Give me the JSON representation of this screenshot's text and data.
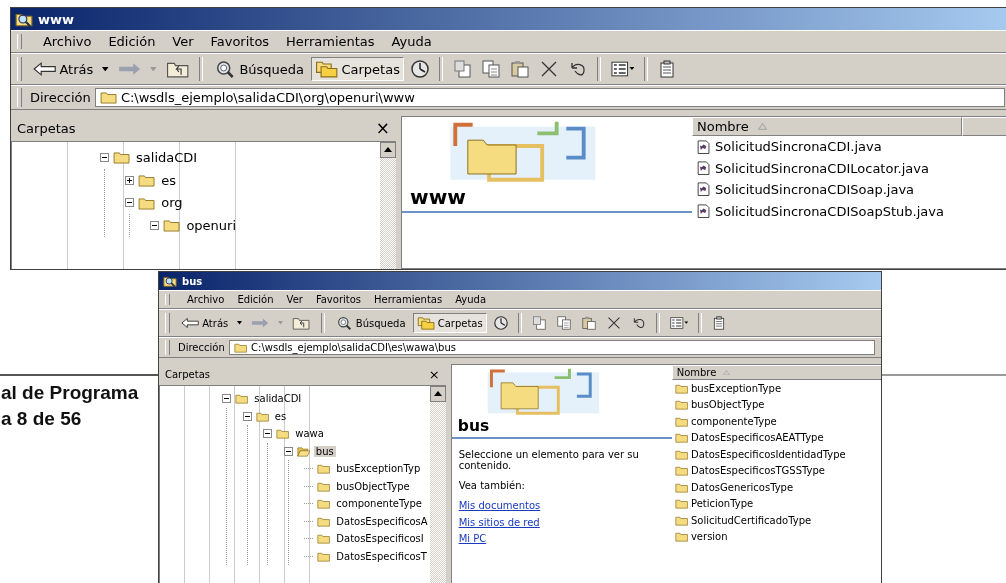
{
  "document": {
    "heading_lines": [
      "al de Programa",
      "a 8 de 56"
    ]
  },
  "windows": [
    {
      "title": "www",
      "menu": [
        "Archivo",
        "Edición",
        "Ver",
        "Favoritos",
        "Herramientas",
        "Ayuda"
      ],
      "toolbar": {
        "back": "Atrás",
        "search": "Búsqueda",
        "folders": "Carpetas",
        "folders_selected": true
      },
      "address": {
        "label": "Dirección",
        "value": "C:\\wsdls_ejemplo\\salidaCDI\\org\\openuri\\www"
      },
      "folders_pane": {
        "title": "Carpetas",
        "close": "×",
        "tree": [
          {
            "label": "salidaCDI",
            "expanded": true,
            "selected": false,
            "children": [
              {
                "label": "es",
                "expanded": false,
                "selected": false
              },
              {
                "label": "org",
                "expanded": true,
                "selected": false,
                "children": [
                  {
                    "label": "openuri",
                    "expanded": true,
                    "selected": false
                  }
                ]
              }
            ]
          }
        ]
      },
      "info_panel": {
        "title": "www"
      },
      "file_list": {
        "column": "Nombre",
        "files": [
          {
            "name": "SolicitudSincronaCDI.java",
            "kind": "java"
          },
          {
            "name": "SolicitudSincronaCDILocator.java",
            "kind": "java"
          },
          {
            "name": "SolicitudSincronaCDISoap.java",
            "kind": "java"
          },
          {
            "name": "SolicitudSincronaCDISoapStub.java",
            "kind": "java"
          }
        ]
      }
    },
    {
      "title": "bus",
      "menu": [
        "Archivo",
        "Edición",
        "Ver",
        "Favoritos",
        "Herramientas",
        "Ayuda"
      ],
      "toolbar": {
        "back": "Atrás",
        "search": "Búsqueda",
        "folders": "Carpetas",
        "folders_selected": true
      },
      "address": {
        "label": "Dirección",
        "value": "C:\\wsdls_ejemplo\\salidaCDI\\es\\wawa\\bus"
      },
      "folders_pane": {
        "title": "Carpetas",
        "close": "×",
        "tree": [
          {
            "label": "salidaCDI",
            "expanded": true,
            "selected": false,
            "children": [
              {
                "label": "es",
                "expanded": true,
                "selected": false,
                "children": [
                  {
                    "label": "wawa",
                    "expanded": true,
                    "selected": false,
                    "children": [
                      {
                        "label": "bus",
                        "expanded": true,
                        "selected": true,
                        "children": [
                          {
                            "label": "busExceptionTyp",
                            "selected": false
                          },
                          {
                            "label": "busObjectType",
                            "selected": false
                          },
                          {
                            "label": "componenteType",
                            "selected": false
                          },
                          {
                            "label": "DatosEspecificosA",
                            "selected": false
                          },
                          {
                            "label": "DatosEspecificosI",
                            "selected": false
                          },
                          {
                            "label": "DatosEspecificosT",
                            "selected": false
                          }
                        ]
                      }
                    ]
                  }
                ]
              }
            ]
          }
        ]
      },
      "info_panel": {
        "title": "bus",
        "description": "Seleccione un elemento para ver su contenido.",
        "see_also": "Vea también:",
        "links": [
          "Mis documentos",
          "Mis sitios de red",
          "Mi PC"
        ]
      },
      "file_list": {
        "column": "Nombre",
        "files": [
          {
            "name": "busExceptionType",
            "kind": "folder"
          },
          {
            "name": "busObjectType",
            "kind": "folder"
          },
          {
            "name": "componenteType",
            "kind": "folder"
          },
          {
            "name": "DatosEspecificosAEATType",
            "kind": "folder"
          },
          {
            "name": "DatosEspecificosIdentidadType",
            "kind": "folder"
          },
          {
            "name": "DatosEspecificosTGSSType",
            "kind": "folder"
          },
          {
            "name": "DatosGenericosType",
            "kind": "folder"
          },
          {
            "name": "PeticionType",
            "kind": "folder"
          },
          {
            "name": "SolicitudCertificadoType",
            "kind": "folder"
          },
          {
            "name": "version",
            "kind": "folder"
          }
        ]
      }
    }
  ]
}
